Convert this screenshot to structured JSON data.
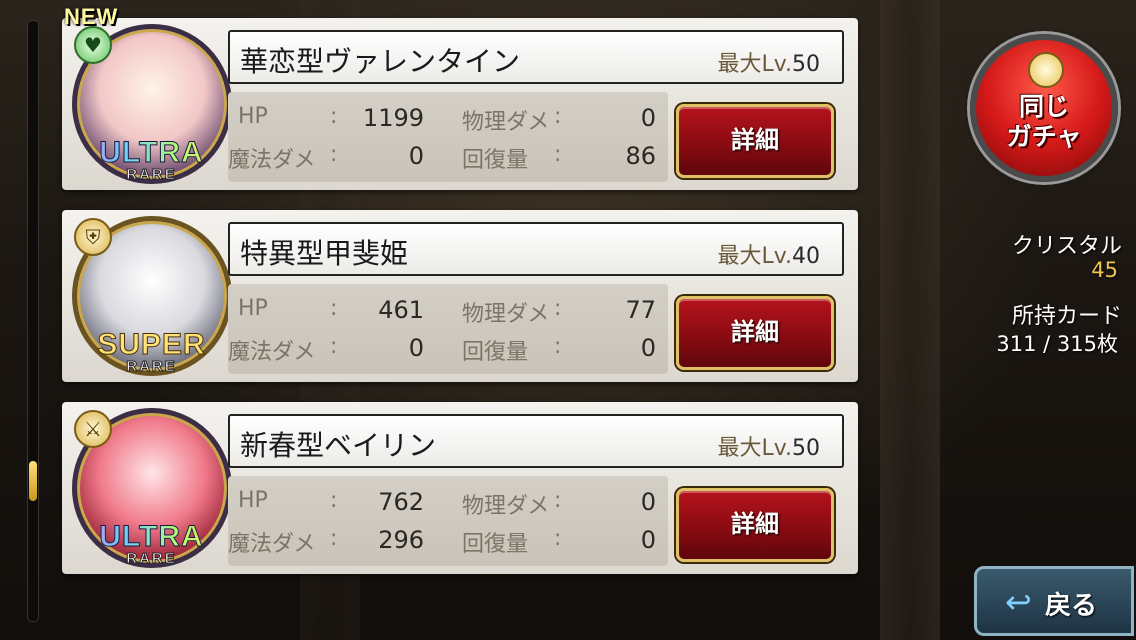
{
  "cards": [
    {
      "new_badge": "NEW",
      "type_icon": "heart-icon",
      "rarity_main": "ULTRA",
      "rarity_sub": "RARE",
      "name": "華恋型ヴァレンタイン",
      "maxlv_label": "最大Lv.",
      "maxlv_value": "50",
      "stats": {
        "hp_label": "HP",
        "hp": "1199",
        "phys_label": "物理ダメ",
        "phys": "0",
        "magic_label": "魔法ダメ",
        "magic": "0",
        "heal_label": "回復量",
        "heal": "86"
      },
      "detail_label": "詳細"
    },
    {
      "new_badge": "",
      "type_icon": "shield-icon",
      "rarity_main": "SUPER",
      "rarity_sub": "RARE",
      "name": "特異型甲斐姫",
      "maxlv_label": "最大Lv.",
      "maxlv_value": "40",
      "stats": {
        "hp_label": "HP",
        "hp": "461",
        "phys_label": "物理ダメ",
        "phys": "77",
        "magic_label": "魔法ダメ",
        "magic": "0",
        "heal_label": "回復量",
        "heal": "0"
      },
      "detail_label": "詳細"
    },
    {
      "new_badge": "",
      "type_icon": "crossed-swords-icon",
      "rarity_main": "ULTRA",
      "rarity_sub": "RARE",
      "name": "新春型ベイリン",
      "maxlv_label": "最大Lv.",
      "maxlv_value": "50",
      "stats": {
        "hp_label": "HP",
        "hp": "762",
        "phys_label": "物理ダメ",
        "phys": "0",
        "magic_label": "魔法ダメ",
        "magic": "296",
        "heal_label": "回復量",
        "heal": "0"
      },
      "detail_label": "詳細"
    }
  ],
  "sidebar": {
    "gacha_button_line1": "同じ",
    "gacha_button_line2": "ガチャ",
    "crystal_label": "クリスタル",
    "crystal_value": "45",
    "cards_label": "所持カード",
    "cards_value": "311 / 315枚"
  },
  "back_button": {
    "label": "戻る"
  },
  "colors": {
    "detail_button": "#a30f17",
    "gacha_button": "#d61a1a",
    "crystal_value": "#f2c64a"
  }
}
